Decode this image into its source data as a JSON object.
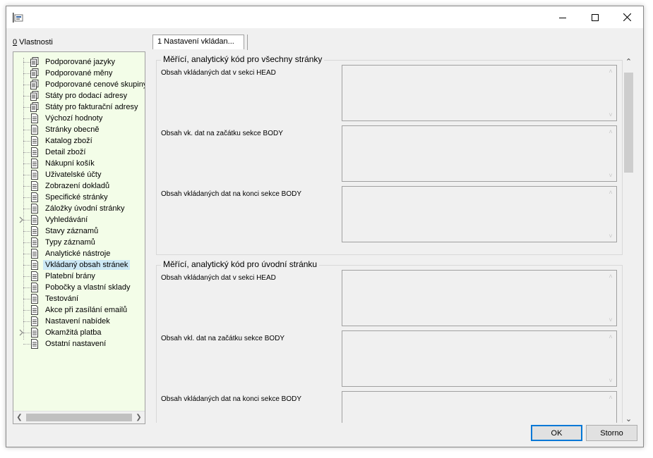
{
  "window": {
    "title": "",
    "buttons": {
      "minimize": "minimize-icon",
      "maximize": "maximize-icon",
      "close": "close-icon"
    }
  },
  "left_panel": {
    "label_accel": "0",
    "label_rest": " Vlastnosti",
    "items": [
      {
        "label": "Podporované jazyky",
        "icon": "document-stack-icon",
        "expandable": false
      },
      {
        "label": "Podporované měny",
        "icon": "document-stack-icon",
        "expandable": false
      },
      {
        "label": "Podporované cenové skupiny",
        "icon": "document-stack-icon",
        "expandable": false
      },
      {
        "label": "Státy pro dodací adresy",
        "icon": "document-stack-icon",
        "expandable": false
      },
      {
        "label": "Státy pro fakturační adresy",
        "icon": "document-stack-icon",
        "expandable": false
      },
      {
        "label": "Výchozí hodnoty",
        "icon": "document-icon",
        "expandable": false
      },
      {
        "label": "Stránky obecně",
        "icon": "document-icon",
        "expandable": false
      },
      {
        "label": "Katalog zboží",
        "icon": "document-icon",
        "expandable": false
      },
      {
        "label": "Detail zboží",
        "icon": "document-icon",
        "expandable": false
      },
      {
        "label": "Nákupní košík",
        "icon": "document-icon",
        "expandable": false
      },
      {
        "label": "Uživatelské účty",
        "icon": "document-icon",
        "expandable": false
      },
      {
        "label": "Zobrazení dokladů",
        "icon": "document-icon",
        "expandable": false
      },
      {
        "label": "Specifické stránky",
        "icon": "document-icon",
        "expandable": false
      },
      {
        "label": "Záložky úvodní stránky",
        "icon": "document-icon",
        "expandable": false
      },
      {
        "label": "Vyhledávání",
        "icon": "document-icon",
        "expandable": true
      },
      {
        "label": "Stavy záznamů",
        "icon": "document-icon",
        "expandable": false
      },
      {
        "label": "Typy záznamů",
        "icon": "document-icon",
        "expandable": false
      },
      {
        "label": "Analytické nástroje",
        "icon": "document-icon",
        "expandable": false
      },
      {
        "label": "Vkládaný obsah stránek",
        "icon": "document-icon",
        "expandable": false,
        "selected": true
      },
      {
        "label": "Platební brány",
        "icon": "document-icon",
        "expandable": false
      },
      {
        "label": "Pobočky a vlastní sklady",
        "icon": "document-icon",
        "expandable": false
      },
      {
        "label": "Testování",
        "icon": "document-icon",
        "expandable": false
      },
      {
        "label": "Akce při zasílání emailů",
        "icon": "document-icon",
        "expandable": false
      },
      {
        "label": "Nastavení nabídek",
        "icon": "document-icon",
        "expandable": false
      },
      {
        "label": "Okamžitá platba",
        "icon": "document-icon",
        "expandable": true
      },
      {
        "label": "Ostatní nastavení",
        "icon": "document-icon",
        "expandable": false
      }
    ]
  },
  "tabs": [
    {
      "label": "1 Nastavení vkládan..."
    }
  ],
  "groups": [
    {
      "title": "Měřící, analytický kód pro všechny stránky",
      "fields": [
        {
          "label": "Obsah vkládaných dat v sekci HEAD",
          "value": ""
        },
        {
          "label": "Obsah vk. dat na začátku sekce BODY",
          "value": ""
        },
        {
          "label": "Obsah vkládaných dat na konci sekce BODY",
          "value": ""
        }
      ]
    },
    {
      "title": "Měřící, analytický kód pro úvodní stránku",
      "fields": [
        {
          "label": "Obsah vkládaných dat v sekci HEAD",
          "value": ""
        },
        {
          "label": "Obsah vkl. dat na začátku sekce BODY",
          "value": ""
        },
        {
          "label": "Obsah vkládaných dat na konci sekce BODY",
          "value": ""
        }
      ]
    }
  ],
  "footer": {
    "ok_label": "OK",
    "cancel_label": "Storno"
  },
  "colors": {
    "tree_background": "#f3fde8",
    "selection": "#cce8f6",
    "default_button_border": "#0078d7"
  }
}
